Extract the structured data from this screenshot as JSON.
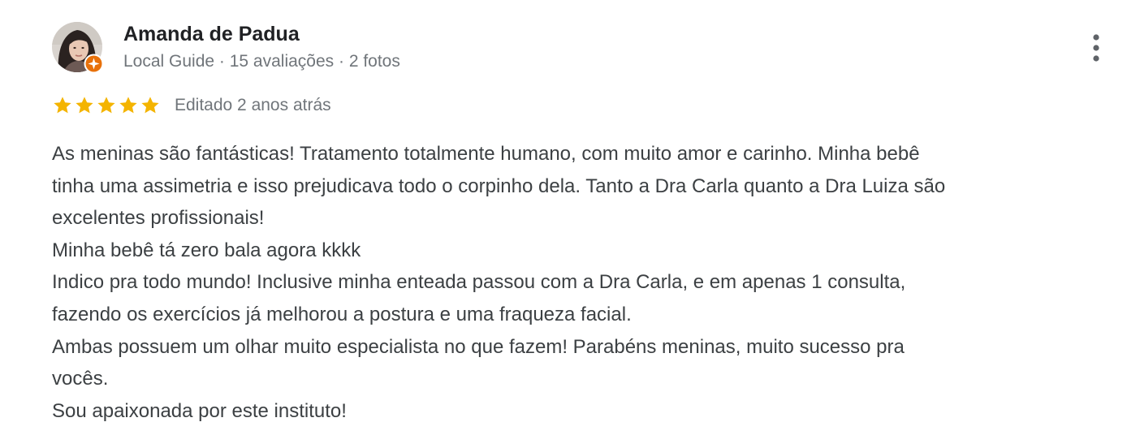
{
  "review": {
    "author_name": "Amanda de Padua",
    "author_meta": "Local Guide · 15 avaliações · 2 fotos",
    "rating": 5,
    "rating_max": 5,
    "edited_label": "Editado 2 anos atrás",
    "body_lines": [
      "As meninas são fantásticas! Tratamento totalmente humano, com muito amor e carinho. Minha bebê",
      "tinha uma assimetria e isso prejudicava todo o corpinho dela. Tanto a Dra Carla quanto a Dra Luiza são",
      "excelentes profissionais!",
      "Minha bebê tá zero bala agora kkkk",
      "Indico pra todo mundo! Inclusive minha enteada passou com a Dra Carla, e em apenas 1 consulta,",
      "fazendo os exercícios já melhorou a postura e uma fraqueza facial.",
      "Ambas possuem um olhar muito especialista no que fazem! Parabéns meninas, muito sucesso pra",
      "vocês.",
      "Sou apaixonada por este instituto!"
    ]
  },
  "icons": {
    "avatar": "user-avatar-photo",
    "badge": "local-guide-badge-icon",
    "more": "more-vert-icon",
    "star": "star-icon"
  },
  "colors": {
    "star": "#f4b400",
    "badge": "#e8710a",
    "name": "#202124",
    "meta": "#70757a",
    "body": "#3c4043",
    "more_dots": "#5f6368"
  }
}
